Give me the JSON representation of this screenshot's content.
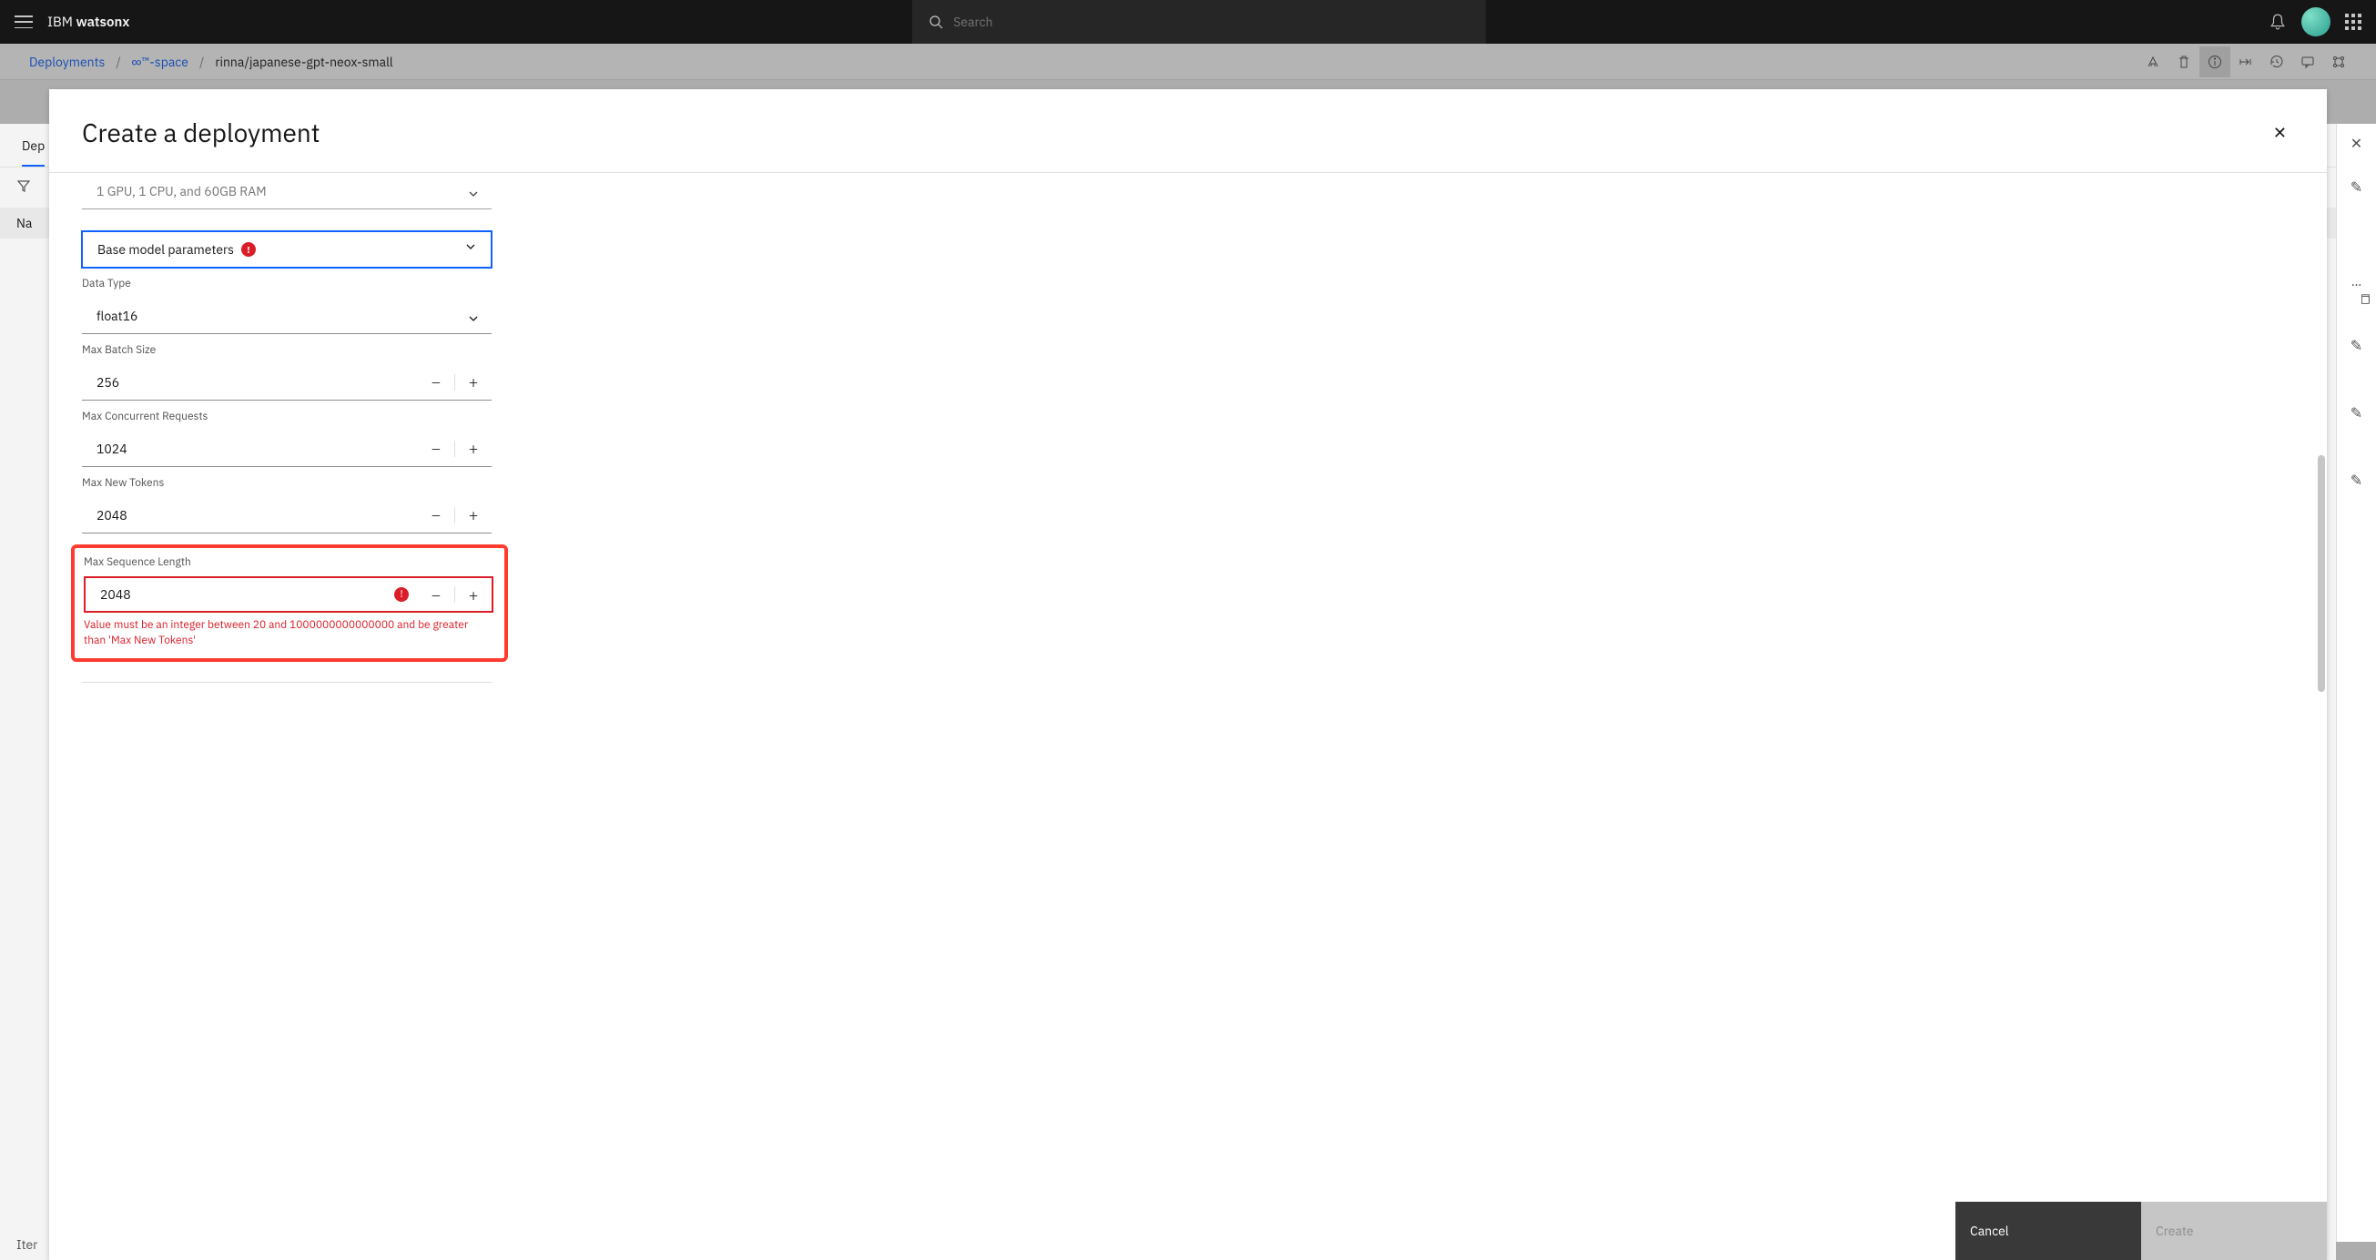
{
  "shell": {
    "brand_prefix": "IBM ",
    "brand_bold": "watsonx",
    "search_placeholder": "Search"
  },
  "breadcrumb": {
    "items": [
      "Deployments",
      "∞™-space",
      "rinna/japanese-gpt-neox-small"
    ]
  },
  "bg": {
    "tab": "Dep",
    "col": "Na",
    "footer": "Iter"
  },
  "info_panel": {
    "ellipsis": "…"
  },
  "modal": {
    "title": "Create a deployment",
    "hardware_value": "1 GPU, 1 CPU, and 60GB RAM",
    "accordion_title": "Base model parameters",
    "fields": {
      "data_type": {
        "label": "Data Type",
        "value": "float16"
      },
      "max_batch": {
        "label": "Max Batch Size",
        "value": "256"
      },
      "max_concurrent": {
        "label": "Max Concurrent Requests",
        "value": "1024"
      },
      "max_new_tokens": {
        "label": "Max New Tokens",
        "value": "2048"
      },
      "max_seq_len": {
        "label": "Max Sequence Length",
        "value": "2048",
        "error": "Value must be an integer between 20 and 1000000000000000 and be greater than 'Max New Tokens'"
      }
    },
    "footer": {
      "cancel": "Cancel",
      "create": "Create"
    }
  }
}
